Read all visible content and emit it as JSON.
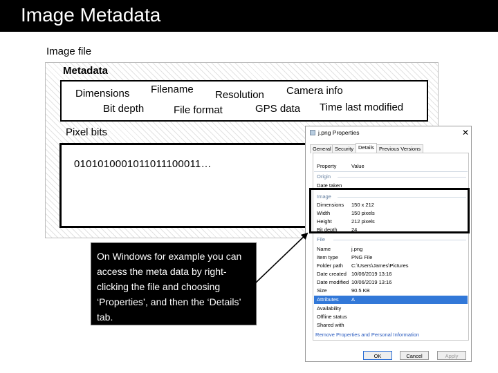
{
  "slide": {
    "title": "Image Metadata",
    "image_file_label": "Image file",
    "metadata_label": "Metadata",
    "metadata_words": {
      "dimensions": "Dimensions",
      "filename": "Filename",
      "resolution": "Resolution",
      "camera_info": "Camera info",
      "bit_depth": "Bit depth",
      "file_format": "File format",
      "gps_data": "GPS data",
      "time_last_modified": "Time last modified"
    },
    "pixel_bits_label": "Pixel bits",
    "pixel_bits_value": "0101010001011011100011…",
    "note_text": "On Windows for example you can access the meta data by right-clicking the file and choosing ‘Properties’, and then the ‘Details’ tab."
  },
  "properties_window": {
    "title": "j.png Properties",
    "close_glyph": "✕",
    "tabs": [
      "General",
      "Security",
      "Details",
      "Previous Versions"
    ],
    "active_tab": "Details",
    "columns": {
      "property": "Property",
      "value": "Value"
    },
    "sections": {
      "origin": "Origin",
      "image": "Image",
      "file": "File"
    },
    "rows": {
      "date_taken": {
        "name": "Date taken",
        "value": ""
      },
      "dimensions": {
        "name": "Dimensions",
        "value": "150 x 212"
      },
      "width": {
        "name": "Width",
        "value": "150 pixels"
      },
      "height": {
        "name": "Height",
        "value": "212 pixels"
      },
      "bit_depth": {
        "name": "Bit depth",
        "value": "24"
      },
      "name": {
        "name": "Name",
        "value": "j.png"
      },
      "item_type": {
        "name": "Item type",
        "value": "PNG File"
      },
      "folder_path": {
        "name": "Folder path",
        "value": "C:\\Users\\James\\Pictures"
      },
      "date_created": {
        "name": "Date created",
        "value": "10/06/2019 13:16"
      },
      "date_modified": {
        "name": "Date modified",
        "value": "10/06/2019 13:16"
      },
      "size": {
        "name": "Size",
        "value": "90.5 KB"
      },
      "attributes": {
        "name": "Attributes",
        "value": "A"
      },
      "availability": {
        "name": "Availability",
        "value": ""
      },
      "offline_status": {
        "name": "Offline status",
        "value": ""
      },
      "shared_with": {
        "name": "Shared with",
        "value": ""
      }
    },
    "remove_link": "Remove Properties and Personal Information",
    "buttons": {
      "ok": "OK",
      "cancel": "Cancel",
      "apply": "Apply"
    }
  }
}
